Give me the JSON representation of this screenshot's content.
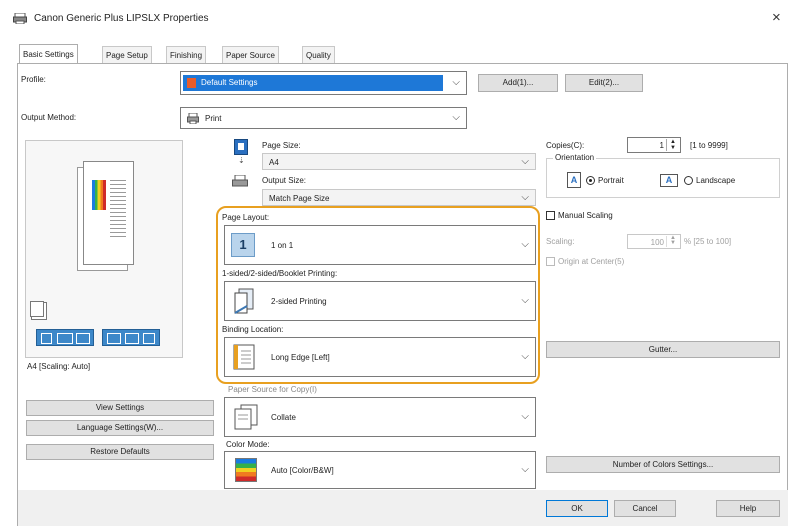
{
  "window": {
    "title": "Canon Generic Plus LIPSLX Properties",
    "close": "×"
  },
  "tabs": [
    "Basic Settings",
    "Page Setup",
    "Finishing",
    "Paper Source",
    "Quality"
  ],
  "profile": {
    "label": "Profile:",
    "value": "Default Settings",
    "add": "Add(1)...",
    "edit": "Edit(2)..."
  },
  "output_method": {
    "label": "Output Method:",
    "value": "Print"
  },
  "preview": {
    "caption": "A4 [Scaling: Auto]"
  },
  "page_size": {
    "label": "Page Size:",
    "value": "A4"
  },
  "output_size": {
    "label": "Output Size:",
    "value": "Match Page Size"
  },
  "page_layout": {
    "label": "Page Layout:",
    "value": "1 on 1",
    "icon_number": "1"
  },
  "printing_mode": {
    "label": "1-sided/2-sided/Booklet Printing:",
    "value": "2-sided Printing"
  },
  "binding": {
    "label": "Binding Location:",
    "value": "Long Edge [Left]"
  },
  "output_order": {
    "label": "Paper Source for Copy(I)",
    "value": "Collate"
  },
  "color_mode": {
    "label": "Color Mode:",
    "value": "Auto [Color/B&W]"
  },
  "copies": {
    "label": "Copies(C):",
    "value": "1",
    "range": "[1 to 9999]"
  },
  "orientation": {
    "label": "Orientation",
    "portrait": "Portrait",
    "landscape": "Landscape",
    "icon_letter": "A"
  },
  "manual_scaling": {
    "label": "Manual Scaling"
  },
  "scaling": {
    "label": "Scaling:",
    "value": "100",
    "range": "% [25 to 100]"
  },
  "origin_center": {
    "label": "Origin at Center(5)"
  },
  "buttons": {
    "view_settings": "View Settings",
    "language_settings": "Language Settings(W)...",
    "restore_defaults": "Restore Defaults",
    "gutter": "Gutter...",
    "number_of_colors": "Number of Colors Settings...",
    "ok": "OK",
    "cancel": "Cancel",
    "help": "Help"
  },
  "colors": {
    "accent": "#e8a020",
    "selection": "#1e78d7"
  }
}
